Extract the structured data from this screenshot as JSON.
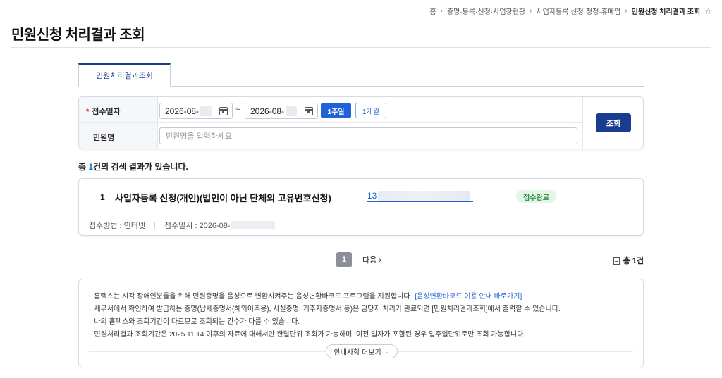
{
  "breadcrumb": {
    "items": [
      "홈",
      "증명·등록·신청·사업장현황",
      "사업자등록 신청·정정·휴폐업",
      "민원신청 처리결과 조회"
    ],
    "separators": [
      "›",
      "›",
      "›"
    ]
  },
  "page": {
    "title": "민원신청 처리결과 조회"
  },
  "tabs": [
    {
      "label": "민원처리결과조회",
      "active": true
    }
  ],
  "search": {
    "date_label": "접수일자",
    "required_mark": "*",
    "date_from": "2026-08-",
    "date_to": "2026-08-",
    "tilde": "~",
    "week_button": "1주일",
    "month_button": "1개월",
    "name_label": "민원명",
    "name_placeholder": "민원명을 입력하세요",
    "search_button": "조회"
  },
  "result_summary": {
    "prefix": "총 ",
    "count": "1",
    "suffix": "건의 검색 결과가 있습니다."
  },
  "results": [
    {
      "no": "1",
      "title": "사업자등록 신청(개인)(법인이 아닌 단체의 고유번호신청)",
      "link_text": "13",
      "status": "접수완료",
      "method_label": "접수방법 : 인터넷",
      "date_label": "접수일시 : 2026-08-"
    }
  ],
  "pagination": {
    "current": "1",
    "next": "다음",
    "next_icon": "›",
    "total": "총 1건"
  },
  "notices": {
    "items": [
      "홈택스는 시각 장애인분들을 위해 민원증명을 음성으로 변환시켜주는 음성변환바코드 프로그램을 지원합니다.",
      "세무서에서 확인하여 발급하는 증명(납세증명서(해외이주용), 사실증명, 거주자증명서 등)은 담당자 처리가 완료되면 [민원처리결과조회]에서 출력할 수 있습니다.",
      "나의 홈택스와 조회기간이 다르므로 조회되는 건수가 다를 수 있습니다.",
      "민원처리결과 조회기간은 2025.11.14 이후의 자료에 대해서만 한달단위 조회가 가능하며, 이전 일자가 포함된 경우 일주일단위로만 조회 가능합니다."
    ],
    "link": "[음성변환바코드 이용 안내 바로가기]",
    "more_button": "안내사항 더보기",
    "more_icon": "⌄"
  },
  "colors": {
    "primary": "#1a3c8f",
    "accent": "#1f64d6",
    "status_green": "#2d8a43"
  }
}
